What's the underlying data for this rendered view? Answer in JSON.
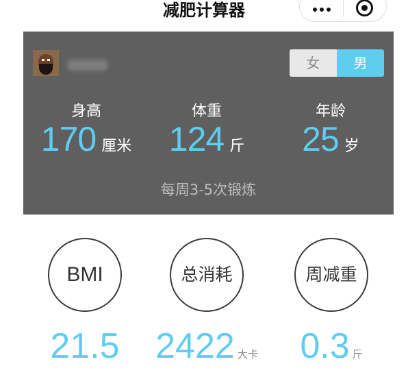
{
  "nav": {
    "title": "减肥计算器",
    "more_icon": "more-dots-icon",
    "target_icon": "target-icon"
  },
  "profile": {
    "avatar_icon": "user-avatar",
    "gender_options": [
      "女",
      "男"
    ],
    "gender_selected": "男"
  },
  "stats": {
    "height": {
      "label": "身高",
      "value": "170",
      "unit": "厘米"
    },
    "weight": {
      "label": "体重",
      "value": "124",
      "unit": "斤"
    },
    "age": {
      "label": "年龄",
      "value": "25",
      "unit": "岁"
    }
  },
  "exercise": "每周3-5次锻炼",
  "results": {
    "bmi": {
      "label": "BMI",
      "value": "21.5",
      "unit": ""
    },
    "consume": {
      "label": "总消耗",
      "value": "2422",
      "unit": "大卡"
    },
    "loss": {
      "label": "周减重",
      "value": "0.3",
      "unit": "斤"
    }
  },
  "colors": {
    "accent": "#5fcdf0",
    "panel": "#5f5f5f",
    "toggle_off": "#e8e8e8"
  }
}
